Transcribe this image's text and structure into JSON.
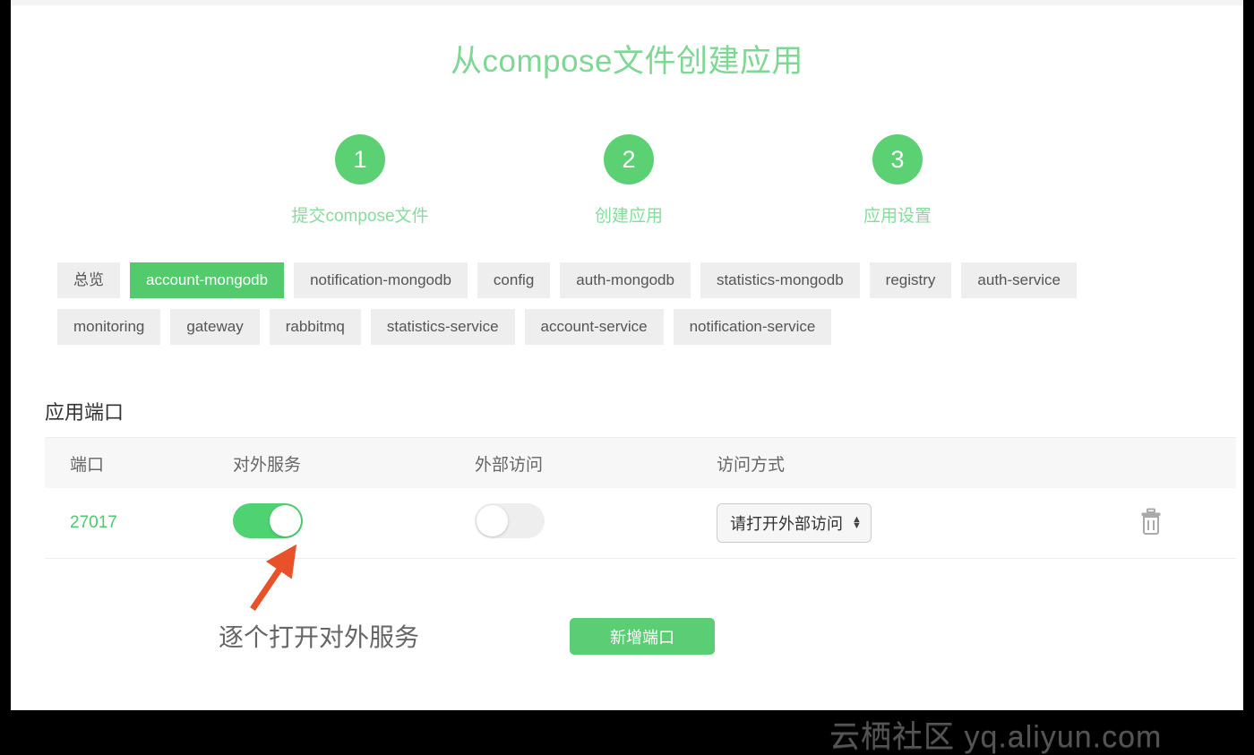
{
  "page": {
    "title": "从compose文件创建应用"
  },
  "steps": [
    {
      "number": "1",
      "label": "提交compose文件"
    },
    {
      "number": "2",
      "label": "创建应用"
    },
    {
      "number": "3",
      "label": "应用设置"
    }
  ],
  "tabs": {
    "active_index": 1,
    "items": [
      {
        "label": "总览"
      },
      {
        "label": "account-mongodb"
      },
      {
        "label": "notification-mongodb"
      },
      {
        "label": "config"
      },
      {
        "label": "auth-mongodb"
      },
      {
        "label": "statistics-mongodb"
      },
      {
        "label": "registry"
      },
      {
        "label": "auth-service"
      },
      {
        "label": "monitoring"
      },
      {
        "label": "gateway"
      },
      {
        "label": "rabbitmq"
      },
      {
        "label": "statistics-service"
      },
      {
        "label": "account-service"
      },
      {
        "label": "notification-service"
      }
    ]
  },
  "ports_section": {
    "title": "应用端口",
    "columns": {
      "port": "端口",
      "external_service": "对外服务",
      "external_access": "外部访问",
      "access_mode": "访问方式"
    },
    "rows": [
      {
        "port": "27017",
        "external_service_on": "true",
        "external_access_on": "false",
        "access_mode_value": "请打开外部访问",
        "delete_icon": "trash-icon"
      }
    ],
    "add_button_label": "新增端口"
  },
  "annotation": {
    "text": "逐个打开对外服务",
    "arrow_color": "#e8512a"
  },
  "watermark": {
    "text": "云栖社区 yq.aliyun.com"
  },
  "colors": {
    "brand_green": "#5bd173",
    "active_tab_green": "#53cb6c",
    "title_green": "#7ed894",
    "port_green": "#4fc96d"
  }
}
